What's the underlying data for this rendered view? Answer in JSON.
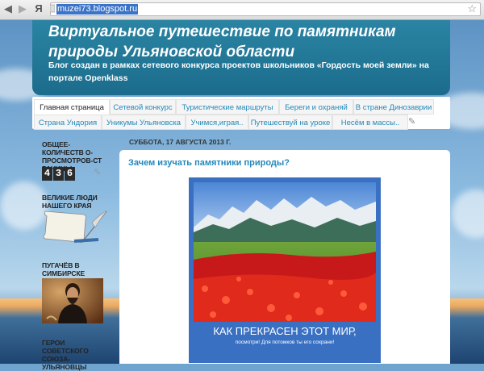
{
  "browser": {
    "back_icon": "back-arrow",
    "forward_icon": "forward-arrow",
    "menu_glyph": "Я",
    "url": "muzei73.blogspot.ru"
  },
  "header": {
    "title": "Виртуальное путешествие по памятникам природы Ульяновской области",
    "description": "Блог создан в рамках сетевого конкурса проектов школьников «Гордость моей земли» на портале Openklass"
  },
  "tabs": {
    "row1": [
      "Главная страница",
      "Сетевой конкурс",
      "Туристические маршруты",
      "Береги и охраняй",
      "В стране Динозаврии"
    ],
    "row2": [
      "Страна Ундория",
      "Уникумы Ульяновска",
      "Учимся,играя..",
      "Путешествуй на уроке",
      "Несём в массы.."
    ]
  },
  "sidebar": {
    "widgets": [
      {
        "title": "ОБЩЕЕ-КОЛИЧЕСТВ О-ПРОСМОТРОВ-СТ РАНИЦЫ"
      },
      {
        "title": "ВЕЛИКИЕ ЛЮДИ НАШЕГО КРАЯ"
      },
      {
        "title": "ПУГАЧЁВ В СИМБИРСКЕ"
      },
      {
        "title": "ГЕРОИ СОВЕТСКОГО СОЮЗА-УЛЬЯНОВЦЫ"
      }
    ],
    "counter_digits": [
      "4",
      "3",
      "6"
    ]
  },
  "post": {
    "date": "СУББОТА, 17 АВГУСТА 2013 Г.",
    "title": "Зачем изучать памятники природы?",
    "poster_caption": "КАК ПРЕКРАСЕН ЭТОТ МИР,",
    "poster_subcaption": "посмотри! Для потомков ты его сохрани!"
  },
  "colors": {
    "header_bg": "#1f7394",
    "link": "#2288bb",
    "poster_frame": "#3a70c2"
  }
}
